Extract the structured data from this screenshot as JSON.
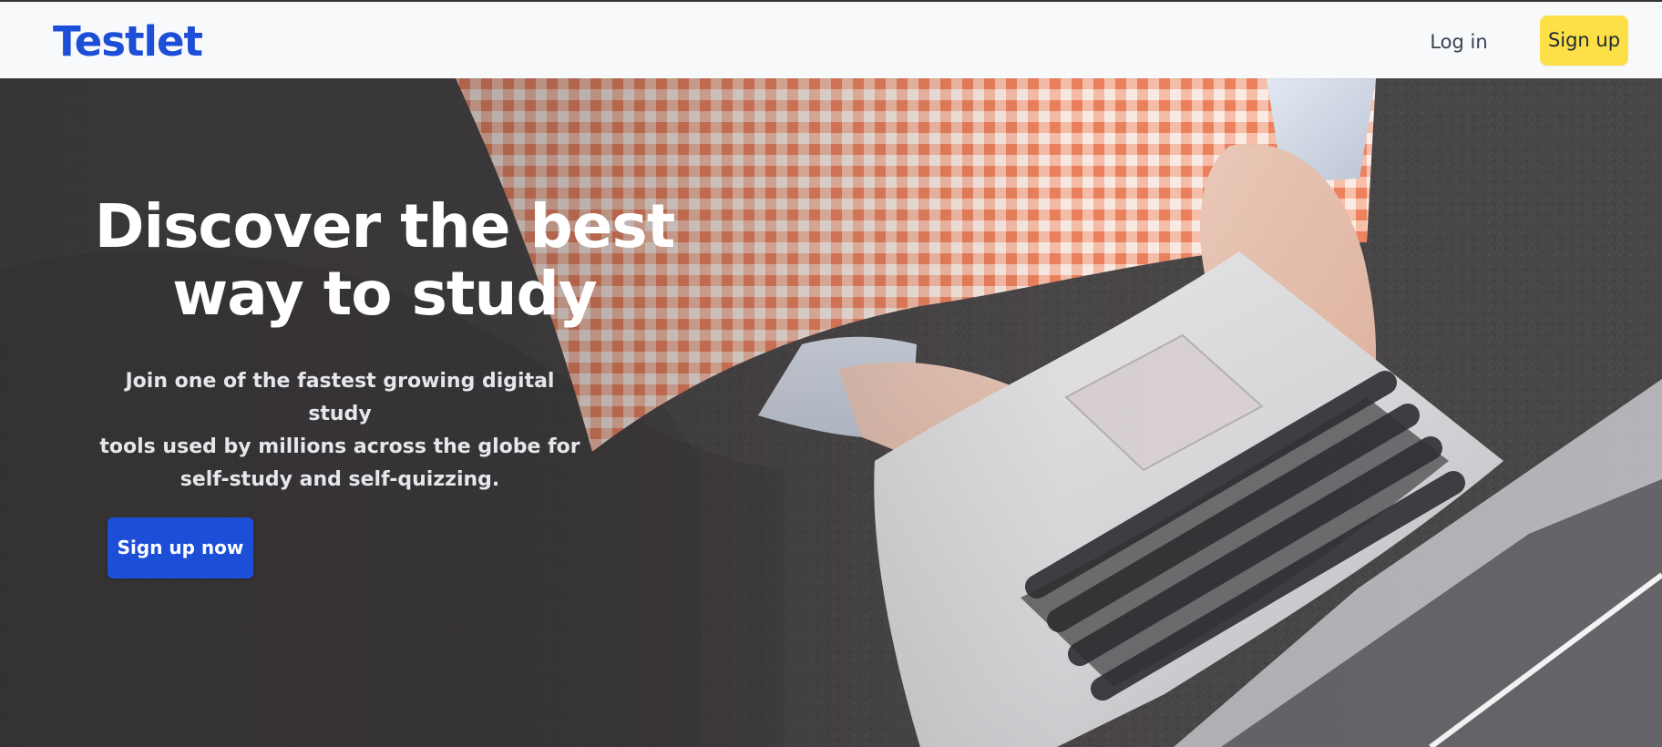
{
  "brand": {
    "name": "Testlet"
  },
  "nav": {
    "login_label": "Log in",
    "signup_label": "Sign up"
  },
  "hero": {
    "title_line1": "Discover the best",
    "title_line2": "way to study",
    "subtitle_line1": "Join one of the fastest growing digital study",
    "subtitle_line2": "tools used by millions across the globe for",
    "subtitle_line3": "self-study and self-quizzing.",
    "cta_label": "Sign up now"
  },
  "colors": {
    "brand_blue": "#1d4ed8",
    "signup_yellow": "#fde047",
    "nav_background": "#f8f9fb",
    "hero_background": "#3f3c3d"
  }
}
